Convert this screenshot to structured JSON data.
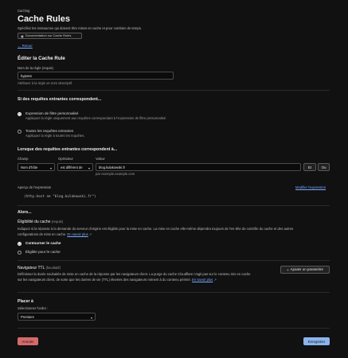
{
  "header": {
    "breadcrumb": "Caching",
    "title": "Cache Rules",
    "subtitle": "Spécifiez les ressources qui doivent être mises en cache et pour combien de temps.",
    "doc_link": "Documentation sur Cache Rules",
    "back_link": "← Retour"
  },
  "form": {
    "heading": "Éditer la Cache Rule",
    "name_label": "Nom de la règle (requis)",
    "name_value": "bypass",
    "name_hint": "Attribuez à la règle un nom descriptif."
  },
  "match": {
    "heading": "Si des requêtes entrantes correspondent...",
    "options": [
      {
        "title": "Expression de filtre personnalisé",
        "desc": "Appliquez la règle uniquement aux requêtes correspondant à l'expression de filtre personnalisé.",
        "selected": true
      },
      {
        "title": "Toutes les requêtes entrantes",
        "desc": "Appliquez la règle à toutes les requêtes.",
        "selected": false
      }
    ]
  },
  "expression": {
    "heading": "Lorsque des requêtes entrantes correspondent à...",
    "field_label": "Champ",
    "operator_label": "Opérateur",
    "value_label": "Valeur",
    "field_value": "Nom d'hôte",
    "operator_value": "est différent de",
    "value_value": "blog.kulakowski.fr",
    "value_hint": "par exemple.example.com",
    "and_button": "Et",
    "or_button": "Ou",
    "preview_label": "Aperçu de l'expression",
    "edit_link": "Modifier l'expression",
    "preview_code": "(http.host ne \"blog.kulakowski.fr\")"
  },
  "then": {
    "heading": "Alors...",
    "eligibility_title": "Éligibilité du cache",
    "eligibility_required": "(requis)",
    "eligibility_desc_1": "Indiquez si la réponse à la demande du serveur d'origine est éligible pour la mise en cache. La mise en cache elle-même dépendra toujours de l'en-tête de contrôle du cache et des autres",
    "eligibility_desc_2": "configurations de mise en cache.",
    "learn_more": "En savoir plus",
    "options": [
      {
        "label": "Contourner le cache",
        "selected": true
      },
      {
        "label": "Éligible pour le cache",
        "selected": false
      }
    ]
  },
  "ttl": {
    "title": "Navigateur TTL",
    "optional": "(facultatif)",
    "desc_1": "Définissez la durée souhaitée de mise en cache de la réponse par les navigateurs client. La purge du cache Cloudflare n'agit pas sur le contenu mis en cache",
    "desc_2": "sur les navigateurs client, de sorte que les durées de vie (TTL) élevées des navigateurs mènent à du contenu périmé.",
    "learn_more": "En savoir plus",
    "add_button": "Ajouter un paramètre"
  },
  "place": {
    "heading": "Placer à",
    "select_label": "Sélectionner l'ordre :",
    "select_value": "Premiere"
  },
  "footer": {
    "cancel": "Annuler",
    "save": "Enregistrer"
  }
}
